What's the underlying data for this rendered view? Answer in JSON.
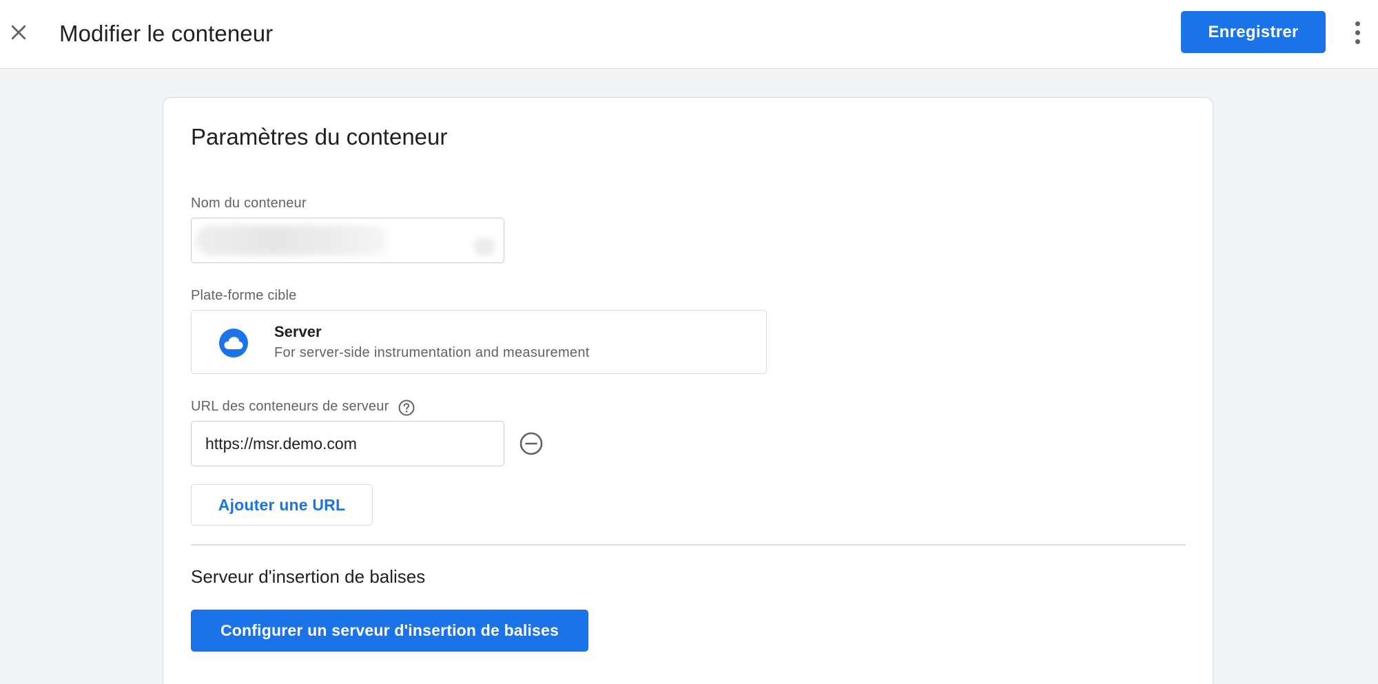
{
  "header": {
    "title": "Modifier le conteneur",
    "save_label": "Enregistrer",
    "close_icon": "close-icon",
    "more_icon": "more-vert-icon"
  },
  "card": {
    "title": "Paramètres du conteneur",
    "container_name": {
      "label": "Nom du conteneur",
      "value": ""
    },
    "target_platform": {
      "label": "Plate-forme cible",
      "name": "Server",
      "description": "For server-side instrumentation and measurement",
      "icon": "cloud-icon"
    },
    "server_urls": {
      "label": "URL des conteneurs de serveur",
      "help_icon": "help-icon",
      "urls": [
        "https://msr.demo.com"
      ],
      "remove_icon": "remove-circle-icon",
      "add_label": "Ajouter une URL"
    },
    "tagging_server": {
      "title": "Serveur d'insertion de balises",
      "configure_label": "Configurer un serveur d'insertion de balises"
    }
  },
  "colors": {
    "primary": "#1a73e8",
    "background": "#f1f3f4",
    "border": "#dadce0",
    "text": "#202124",
    "secondary_text": "#5f6368"
  }
}
